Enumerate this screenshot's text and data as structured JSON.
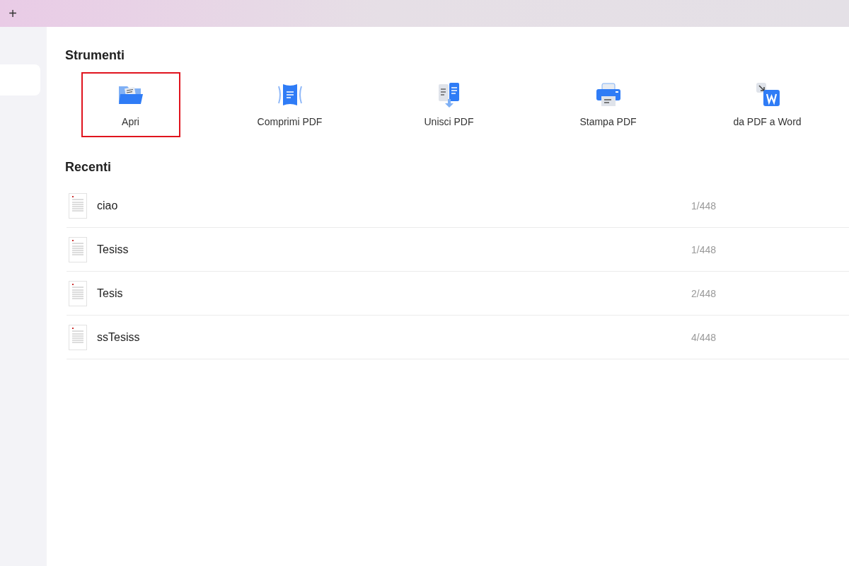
{
  "tab_bar": {
    "new_tab": "+"
  },
  "tools": {
    "title": "Strumenti",
    "items": [
      {
        "kind": "open",
        "label": "Apri",
        "highlighted": true
      },
      {
        "kind": "compress",
        "label": "Comprimi PDF",
        "highlighted": false
      },
      {
        "kind": "merge",
        "label": "Unisci PDF",
        "highlighted": false
      },
      {
        "kind": "print",
        "label": "Stampa PDF",
        "highlighted": false
      },
      {
        "kind": "word",
        "label": "da PDF a Word",
        "highlighted": false
      }
    ]
  },
  "recent": {
    "title": "Recenti",
    "files": [
      {
        "name": "ciao",
        "pages": "1/448"
      },
      {
        "name": "Tesiss",
        "pages": "1/448"
      },
      {
        "name": "Tesis",
        "pages": "2/448"
      },
      {
        "name": "ssTesiss",
        "pages": "4/448"
      }
    ]
  }
}
